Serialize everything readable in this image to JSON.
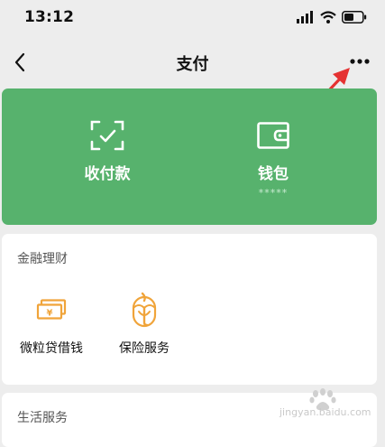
{
  "status": {
    "time": "13:12",
    "icons": [
      "signal-icon",
      "wifi-icon",
      "battery-icon"
    ]
  },
  "nav": {
    "title": "支付",
    "back_icon": "chevron-left-icon",
    "more_icon": "more-dots-icon"
  },
  "green_card": {
    "color": "#57b26d",
    "items": [
      {
        "label": "收付款",
        "icon": "scan-check-icon"
      },
      {
        "label": "钱包",
        "icon": "wallet-icon",
        "sub": "*****"
      }
    ]
  },
  "finance": {
    "title": "金融理财",
    "items": [
      {
        "label": "微粒贷借钱",
        "icon": "cash-icon"
      },
      {
        "label": "保险服务",
        "icon": "insurance-icon"
      }
    ]
  },
  "life": {
    "title": "生活服务"
  },
  "watermark": {
    "text": "jingyan.baidu.com"
  },
  "annotation": {
    "color": "#e53232",
    "icon": "red-arrow-icon"
  }
}
